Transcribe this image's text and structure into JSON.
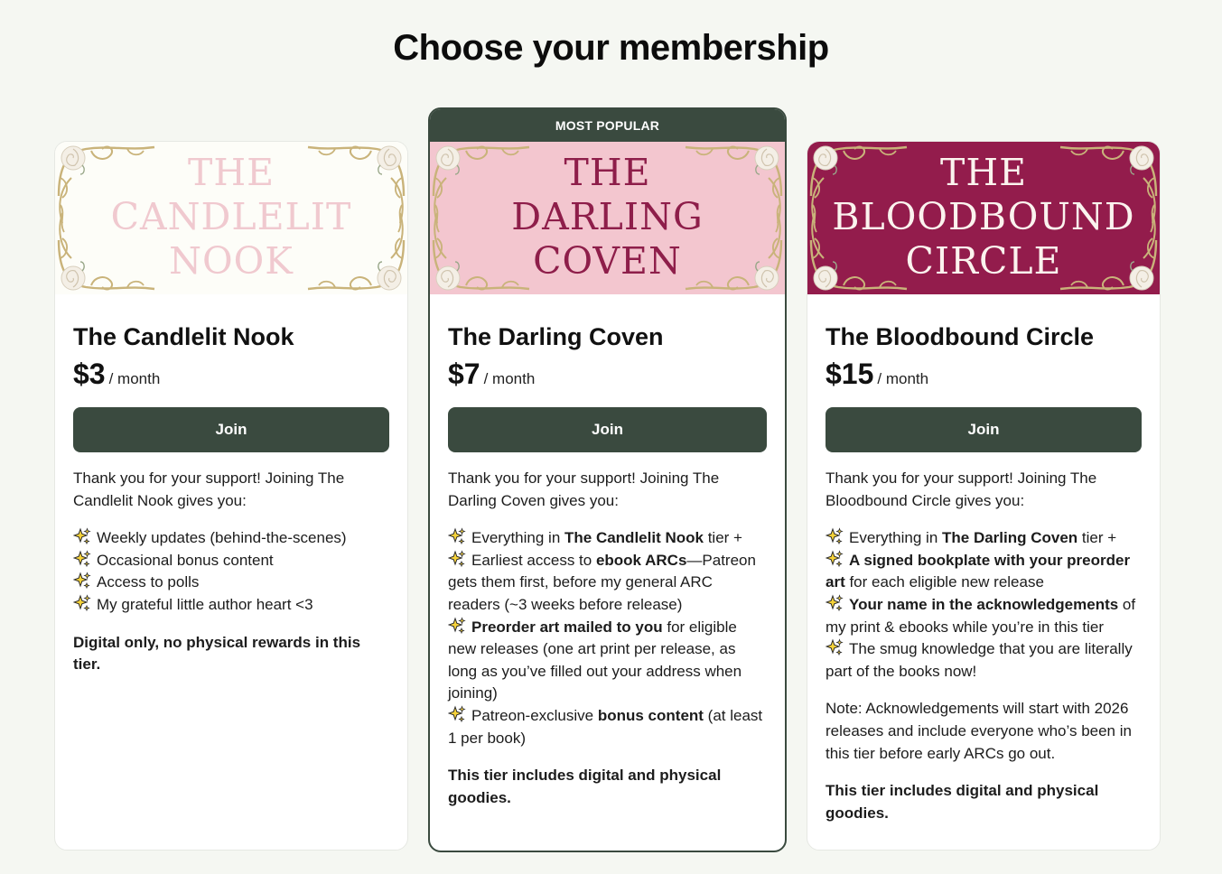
{
  "page": {
    "title": "Choose your membership"
  },
  "colors": {
    "accent": "#3a4a3f",
    "background": "#f5f7f2",
    "gold": "#c9b37a"
  },
  "tiers": [
    {
      "banner_lines": [
        "The",
        "Candlelit",
        "Nook"
      ],
      "banner_bg": "#fdfdf8",
      "banner_text_color": "#f0c9cf",
      "name": "The Candlelit Nook",
      "price": "$3",
      "per": "/ month",
      "join": "Join",
      "intro": "Thank you for your support! Joining The Candlelit Nook gives you:",
      "benefits": [
        [
          {
            "t": "Weekly updates (behind-the-scenes)"
          }
        ],
        [
          {
            "t": "Occasional bonus content"
          }
        ],
        [
          {
            "t": "Access to polls"
          }
        ],
        [
          {
            "t": "My grateful little author heart <3"
          }
        ]
      ],
      "note": "",
      "footer": "Digital only, no physical rewards in this tier."
    },
    {
      "popular": "MOST POPULAR",
      "banner_lines": [
        "The",
        "Darling",
        "Coven"
      ],
      "banner_bg": "#f3c6cf",
      "banner_text_color": "#8e1e4a",
      "name": "The Darling Coven",
      "price": "$7",
      "per": "/ month",
      "join": "Join",
      "intro": "Thank you for your support! Joining The Darling Coven gives you:",
      "benefits": [
        [
          {
            "t": "Everything in "
          },
          {
            "t": "The Candlelit Nook",
            "b": true
          },
          {
            "t": " tier +"
          }
        ],
        [
          {
            "t": "Earliest access to "
          },
          {
            "t": "ebook ARCs",
            "b": true
          },
          {
            "t": "—Patreon gets them first, before my general ARC readers (~3 weeks before release)"
          }
        ],
        [
          {
            "t": "Preorder art mailed to you",
            "b": true
          },
          {
            "t": " for eligible new releases (one art print per release, as long as you’ve filled out your address when joining)"
          }
        ],
        [
          {
            "t": "Patreon-exclusive "
          },
          {
            "t": "bonus content",
            "b": true
          },
          {
            "t": " (at least 1 per book)"
          }
        ]
      ],
      "note": "",
      "footer": "This tier includes digital and physical goodies."
    },
    {
      "banner_lines": [
        "The",
        "Bloodbound",
        "Circle"
      ],
      "banner_bg": "#931c4c",
      "banner_text_color": "#fbf3ee",
      "name": "The Bloodbound Circle",
      "price": "$15",
      "per": "/ month",
      "join": "Join",
      "intro": "Thank you for your support! Joining The Bloodbound Circle gives you:",
      "benefits": [
        [
          {
            "t": "Everything in "
          },
          {
            "t": "The Darling Coven",
            "b": true
          },
          {
            "t": " tier +"
          }
        ],
        [
          {
            "t": "A signed bookplate with your preorder art",
            "b": true
          },
          {
            "t": " for each eligible new release"
          }
        ],
        [
          {
            "t": "Your name in the acknowledgements",
            "b": true
          },
          {
            "t": " of my print & ebooks while you’re in this tier"
          }
        ],
        [
          {
            "t": "The smug knowledge that you are literally part of the books now!"
          }
        ]
      ],
      "note": "Note: Acknowledgements will start with 2026 releases and include everyone who’s been in this tier before early ARCs go out.",
      "footer": "This tier includes digital and physical goodies."
    }
  ],
  "icons": {
    "benefit": "sparkles-icon",
    "banner_corner": "gold-filigree-rose-icon"
  }
}
